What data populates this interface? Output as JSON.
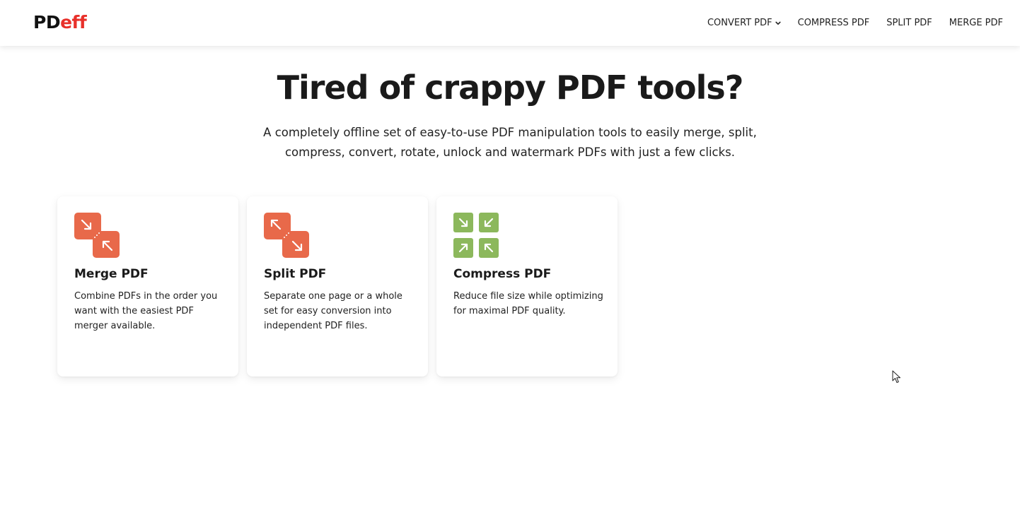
{
  "header": {
    "logo_main": "PD",
    "logo_accent": "eff",
    "nav": [
      {
        "label": "CONVERT PDF",
        "has_dropdown": true
      },
      {
        "label": "COMPRESS PDF"
      },
      {
        "label": "SPLIT PDF"
      },
      {
        "label": "MERGE PDF"
      }
    ]
  },
  "hero": {
    "title": "Tired of crappy PDF tools?",
    "subtitle": "A completely offline set of easy-to-use PDF manipulation tools to easily merge, split, compress, convert, rotate, unlock and watermark PDFs with just a few clicks."
  },
  "tools": [
    {
      "title": "Merge PDF",
      "description": "Combine PDFs in the order you want with the easiest PDF merger available.",
      "icon": "merge-icon",
      "color": "#e8694a"
    },
    {
      "title": "Split PDF",
      "description": "Separate one page or a whole set for easy conversion into independent PDF files.",
      "icon": "split-icon",
      "color": "#e8694a"
    },
    {
      "title": "Compress PDF",
      "description": "Reduce file size while optimizing for maximal PDF quality.",
      "icon": "compress-icon",
      "color": "#8cb85c"
    }
  ],
  "colors": {
    "brand_accent": "#e8302a",
    "tool_orange": "#e8694a",
    "tool_green": "#8cb85c"
  }
}
